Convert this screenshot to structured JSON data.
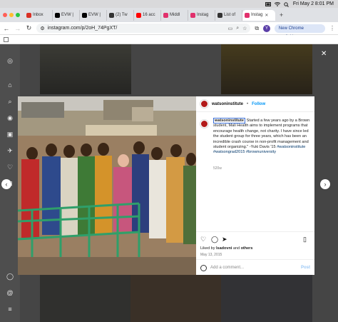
{
  "menubar": {
    "datetime": "Fri May 2  8:01 PM"
  },
  "tabs": [
    {
      "label": "Inbox",
      "color": "#d93025"
    },
    {
      "label": "EVW |",
      "color": "#000000"
    },
    {
      "label": "EVW |",
      "color": "#000000"
    },
    {
      "label": "(2) Tw",
      "color": "#333333"
    },
    {
      "label": "16 acc",
      "color": "#ff0000"
    },
    {
      "label": "Middl",
      "color": "#e1306c"
    },
    {
      "label": "Instag",
      "color": "#e1306c"
    },
    {
      "label": "List of",
      "color": "#333333"
    },
    {
      "label": "Instag",
      "color": "#e1306c"
    }
  ],
  "address": {
    "url": "instagram.com/p/2oH_74PgXT/",
    "profile_initial": "Y",
    "chrome_button": "New Chrome available"
  },
  "post": {
    "username": "watsoninstitute",
    "separator": "•",
    "follow_label": "Follow",
    "caption_user": "watsoninstitute",
    "caption_text": " Started a few years ago by a Brown student, Mali Health aims to implement programs that encourage health change, not charity. I have since led the student group for three years, which has been an incredible crash course in non-profit management and student organizing.\" -Yuki Davis '15 ",
    "caption_tags": "#watsoninstitute #watsongrad2015 #brownuniversity",
    "caption_time": "520w",
    "liked_prefix": "Liked by ",
    "liked_user": "lsadovni",
    "liked_and": " and ",
    "liked_others": "others",
    "date": "May 13, 2015",
    "comment_placeholder": "Add a comment...",
    "post_label": "Post"
  }
}
